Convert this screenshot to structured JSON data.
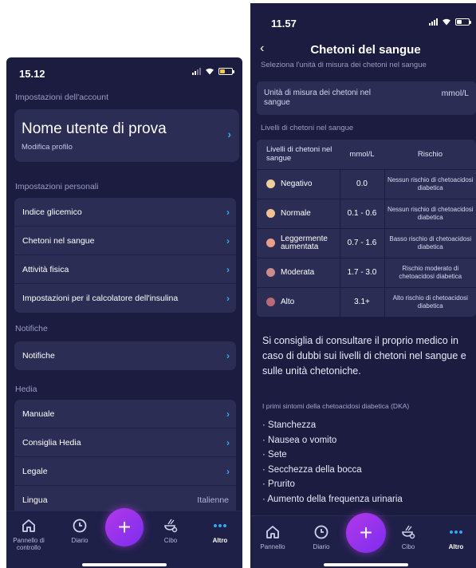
{
  "left": {
    "time": "15.12",
    "account_section": "Impostazioni dell'account",
    "profile_name": "Nome utente di prova",
    "profile_sub": "Modifica profilo",
    "personal_section": "Impostazioni personali",
    "personal_items": [
      "Indice glicemico",
      "Chetoni nel sangue",
      "Attività fisica",
      "Impostazioni per il calcolatore dell'insulina"
    ],
    "notifications_section": "Notifiche",
    "notifications_item": "Notifiche",
    "hedia_section": "Hedia",
    "hedia_items": [
      "Manuale",
      "Consiglia Hedia",
      "Legale"
    ],
    "language_label": "Lingua",
    "language_value": "Italienne",
    "tabs": {
      "dashboard": "Pannello di controllo",
      "diary": "Diario",
      "food": "Cibo",
      "more": "Altro"
    }
  },
  "right": {
    "time": "11.57",
    "title": "Chetoni del sangue",
    "subtitle": "Seleziona l'unità di misura dei chetoni nel sangue",
    "unit_label": "Unità di misura dei chetoni nel sangue",
    "unit_value": "mmol/L",
    "levels_section": "Livelli di chetoni nel sangue",
    "table_headers": [
      "Livelli di chetoni nel sangue",
      "mmol/L",
      "Rischio"
    ],
    "table_rows": [
      {
        "level": "Negativo",
        "range": "0.0",
        "risk": "Nessun rischio di chetoacidosi diabetica",
        "color": "#f1cf9a"
      },
      {
        "level": "Normale",
        "range": "0.1 - 0.6",
        "risk": "Nessun rischio di chetoacidosi diabetica",
        "color": "#f0c292"
      },
      {
        "level": "Leggermente aumentata",
        "range": "0.7 - 1.6",
        "risk": "Basso rischio di chetoacidosi diabetica",
        "color": "#e9a08a"
      },
      {
        "level": "Moderata",
        "range": "1.7 - 3.0",
        "risk": "Rischio moderato di chetoacidosi diabetica",
        "color": "#c98b8b"
      },
      {
        "level": "Alto",
        "range": "3.1+",
        "risk": "Alto rischio di chetoacidosi diabetica",
        "color": "#b96a76"
      }
    ],
    "advice": "Si consiglia di consultare il proprio medico in caso di dubbi sui livelli di chetoni nel sangue e sulle unità chetoniche.",
    "dka_title": "I primi sintomi della chetoacidosi diabetica (DKA)",
    "symptoms": [
      "· Stanchezza",
      "· Nausea o vomito",
      "· Sete",
      "· Secchezza della bocca",
      "· Prurito",
      "· Aumento della frequenza urinaria"
    ],
    "tabs": {
      "dashboard": "Pannello",
      "diary": "Diario",
      "food": "Cibo",
      "more": "Altro"
    }
  },
  "colors": {
    "background": "#1b1c3f",
    "card": "#2c2d55",
    "accent": "#2ea9f3",
    "fab": "#9b34ec"
  }
}
